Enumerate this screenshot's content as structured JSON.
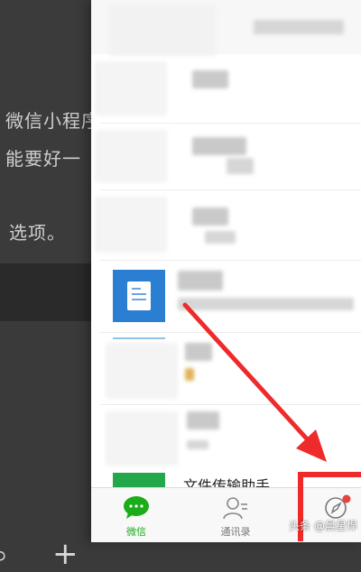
{
  "background_article": {
    "line1": "微信小程序",
    "line2": "能要好一",
    "line3": "选项。"
  },
  "chat_list": {
    "file_helper_title": "文件传输助手"
  },
  "tab_bar": {
    "chats_label": "微信",
    "contacts_label": "通讯录",
    "discover_badge": "red-dot"
  },
  "annotation": {
    "highlight_color": "#ee2a2a"
  },
  "watermark": {
    "text": "头条 @晨星悍"
  },
  "colors": {
    "wechat_green": "#1aad19",
    "doc_icon_blue": "#2b7fd3"
  },
  "icons": {
    "chats": "chat-bubble-icon",
    "contacts": "contacts-icon",
    "discover": "compass-icon",
    "document": "document-icon"
  }
}
